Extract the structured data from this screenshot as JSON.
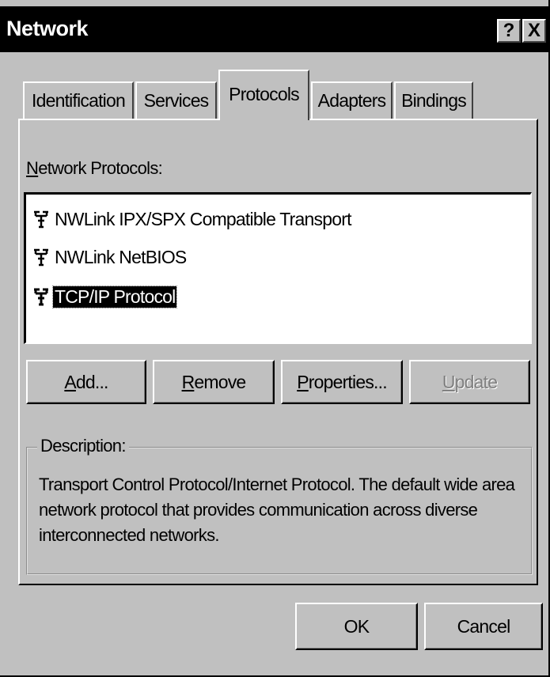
{
  "window": {
    "title": "Network",
    "help_glyph": "?",
    "close_glyph": "X"
  },
  "tabs": [
    {
      "label": "Identification",
      "active": false
    },
    {
      "label": "Services",
      "active": false
    },
    {
      "label": "Protocols",
      "active": true
    },
    {
      "label": "Adapters",
      "active": false
    },
    {
      "label": "Bindings",
      "active": false
    }
  ],
  "protocols": {
    "list_label_prefix": "N",
    "list_label_rest": "etwork Protocols:",
    "items": [
      {
        "label": "NWLink IPX/SPX Compatible Transport",
        "selected": false
      },
      {
        "label": "NWLink NetBIOS",
        "selected": false
      },
      {
        "label": "TCP/IP Protocol",
        "selected": true
      }
    ]
  },
  "buttons": {
    "add": {
      "mnemonic": "A",
      "rest": "dd..."
    },
    "remove": {
      "mnemonic": "R",
      "rest": "emove"
    },
    "properties": {
      "mnemonic": "P",
      "rest": "roperties..."
    },
    "update": {
      "mnemonic": "U",
      "rest": "pdate",
      "enabled": false
    }
  },
  "description": {
    "legend": "Description:",
    "text": "Transport Control Protocol/Internet Protocol. The default wide area network protocol that provides communication across diverse interconnected networks."
  },
  "dialog_buttons": {
    "ok": "OK",
    "cancel": "Cancel"
  },
  "colors": {
    "face": "#c0c0c0",
    "titlebar": "#000000",
    "selection": "#000000",
    "disabled_text": "#808080"
  },
  "icons": {
    "protocol": "network-protocol-icon"
  }
}
